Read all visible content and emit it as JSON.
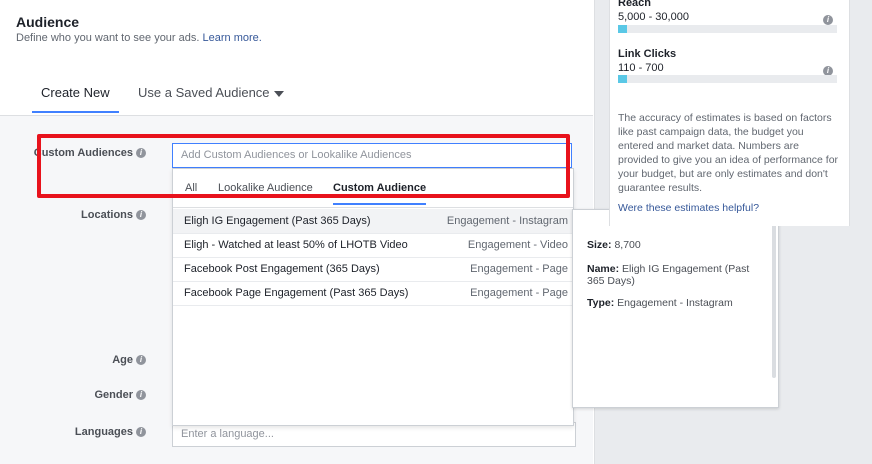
{
  "audience": {
    "title": "Audience",
    "subtitle": "Define who you want to see your ads.",
    "learn_more": "Learn more."
  },
  "tabs": {
    "create_new": "Create New",
    "saved": "Use a Saved Audience"
  },
  "fields": {
    "custom_audiences": "Custom Audiences",
    "locations": "Locations",
    "age": "Age",
    "gender": "Gender",
    "languages": "Languages",
    "custom_audiences_placeholder": "Add Custom Audiences or Lookalike Audiences",
    "languages_placeholder": "Enter a language..."
  },
  "dropdown": {
    "tabs": [
      "All",
      "Lookalike Audience",
      "Custom Audience"
    ],
    "active_tab": "Custom Audience",
    "rows": [
      {
        "name": "Eligh IG Engagement (Past 365 Days)",
        "type": "Engagement - Instagram"
      },
      {
        "name": "Eligh - Watched at least 50% of LHOTB Video",
        "type": "Engagement - Video"
      },
      {
        "name": "Facebook Post Engagement (365 Days)",
        "type": "Engagement - Page"
      },
      {
        "name": "Facebook Page Engagement (Past 365 Days)",
        "type": "Engagement - Page"
      }
    ]
  },
  "tooltip": {
    "size_label": "Size:",
    "size": "8,700",
    "name_label": "Name:",
    "name": "Eligh IG Engagement (Past 365 Days)",
    "type_label": "Type:",
    "type": "Engagement - Instagram"
  },
  "estimates": {
    "reach_label": "Reach",
    "reach_value": "5,000 - 30,000",
    "reach_fill": 0.04,
    "clicks_label": "Link Clicks",
    "clicks_value": "110 - 700",
    "clicks_fill": 0.04,
    "note": "The accuracy of estimates is based on factors like past campaign data, the budget you entered and market data. Numbers are provided to give you an idea of performance for your budget, but are only estimates and don't guarantee results.",
    "helpful": "Were these estimates helpful?"
  },
  "colors": {
    "accent": "#4080ff",
    "highlight": "#e8121c",
    "bar_fill": "#5ac8e6",
    "link": "#365899"
  },
  "icons": {
    "info": "info-icon",
    "caret": "caret-down-icon"
  }
}
